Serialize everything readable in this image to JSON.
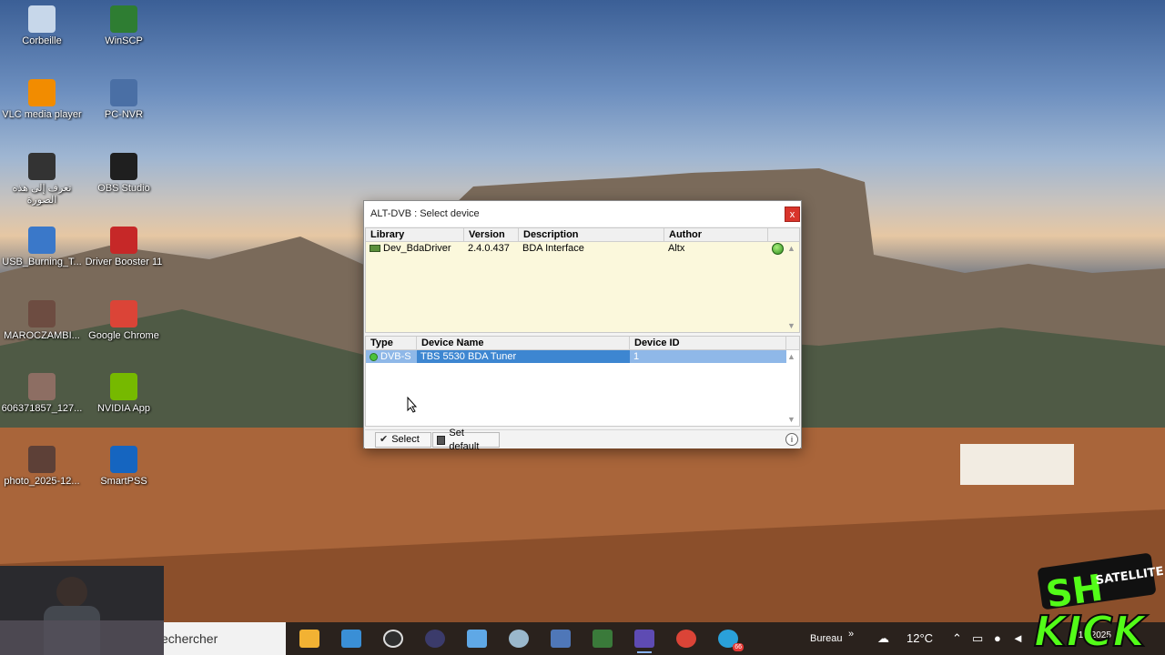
{
  "desktop": {
    "icons": [
      {
        "label": "Corbeille",
        "icon": "recycle-bin-icon",
        "color": "#c7d7ea"
      },
      {
        "label": "WinSCP",
        "icon": "winscp-icon",
        "color": "#2e7d32"
      },
      {
        "label": "VLC media player",
        "icon": "vlc-icon",
        "color": "#f28c00"
      },
      {
        "label": "PC-NVR",
        "icon": "pc-nvr-icon",
        "color": "#4a6fa5"
      },
      {
        "label": "تعرف إلى هذه الصورة",
        "icon": "learn-about-picture-icon",
        "color": "#333333"
      },
      {
        "label": "OBS Studio",
        "icon": "obs-icon",
        "color": "#1f1f1f"
      },
      {
        "label": "USB_Burning_T...",
        "icon": "usb-burning-tool-icon",
        "color": "#3a78c9"
      },
      {
        "label": "Driver Booster 11",
        "icon": "driver-booster-icon",
        "color": "#c62828"
      },
      {
        "label": "MAROCZAMBI...",
        "icon": "maroczambi-icon",
        "color": "#6d4c41"
      },
      {
        "label": "Google Chrome",
        "icon": "chrome-icon",
        "color": "#db4437"
      },
      {
        "label": "606371857_127...",
        "icon": "image-file-icon",
        "color": "#8d6e63"
      },
      {
        "label": "NVIDIA App",
        "icon": "nvidia-icon",
        "color": "#76b900"
      },
      {
        "label": "photo_2025-12...",
        "icon": "photo-file-icon",
        "color": "#5d4037"
      },
      {
        "label": "SmartPSS",
        "icon": "smartpss-icon",
        "color": "#1565c0"
      }
    ]
  },
  "dialog": {
    "title": "ALT-DVB : Select device",
    "close_label": "x",
    "library_table": {
      "headers": [
        "Library",
        "Version",
        "Description",
        "Author"
      ],
      "rows": [
        {
          "library": "Dev_BdaDriver",
          "version": "2.4.0.437",
          "description": "BDA Interface",
          "author": "Altx"
        }
      ]
    },
    "device_table": {
      "headers": [
        "Type",
        "Device Name",
        "Device ID"
      ],
      "rows": [
        {
          "type": "DVB-S",
          "name": "TBS 5530 BDA Tuner",
          "id": "1"
        }
      ]
    },
    "buttons": {
      "select": "Select",
      "set_default": "Set default"
    },
    "info_label": "i"
  },
  "taskbar": {
    "search_text": "echercher",
    "bureau_label": "Bureau",
    "bureau_chevron": "»",
    "weather": "12°C",
    "clock_date": "/12/2025",
    "telegram_badge": "66"
  },
  "overlay": {
    "logo_sh": "SH",
    "logo_satellite": "SATELLITE",
    "logo_kick": "KICK",
    "logo_color": "#53fc18"
  }
}
